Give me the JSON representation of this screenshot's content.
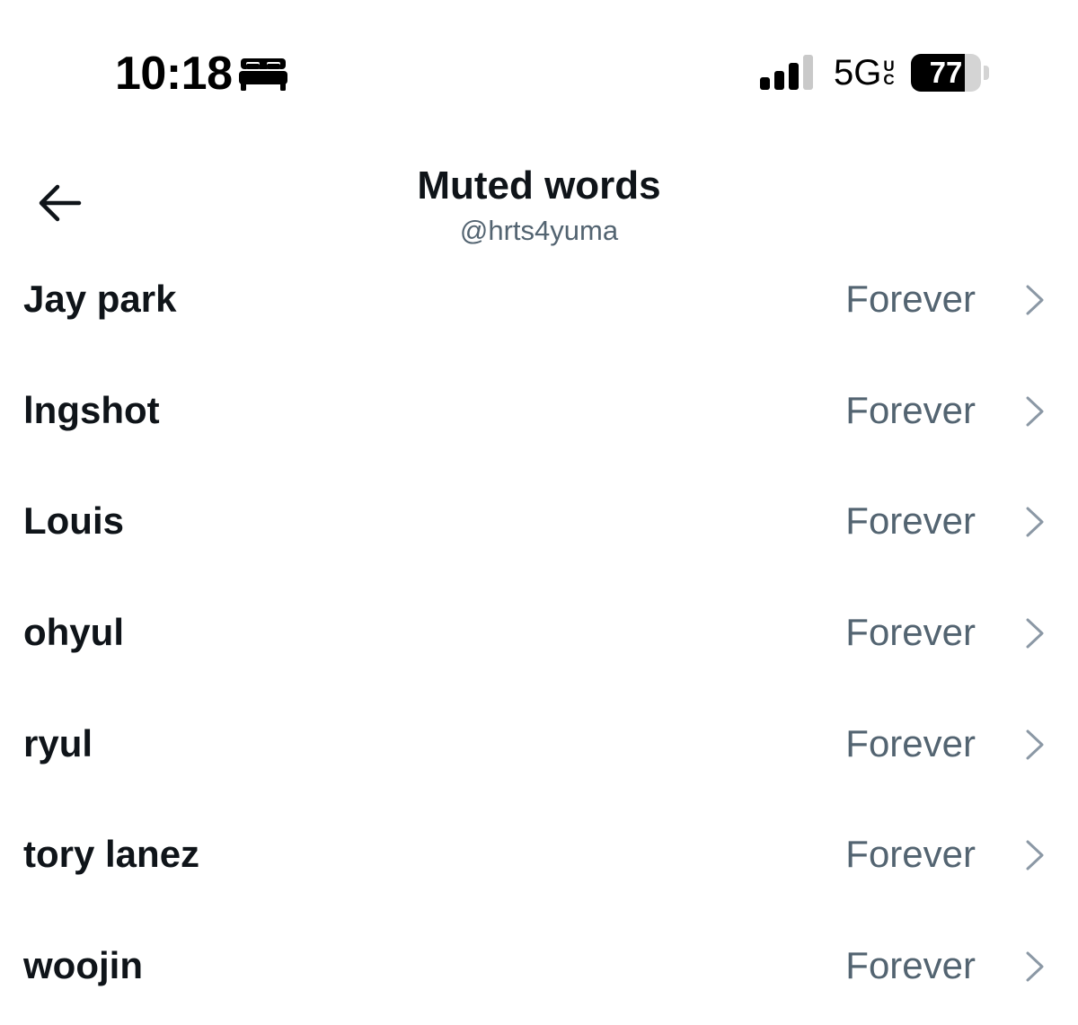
{
  "status_bar": {
    "time": "10:18",
    "focus_icon": "bed-icon",
    "signal_icon": "cellular-signal-icon",
    "signal_bars": 3,
    "network": "5G",
    "network_superscript": "U",
    "network_subscript": "C",
    "battery_level": "77",
    "battery_fraction": 0.77
  },
  "header": {
    "back_icon": "back-arrow-icon",
    "title": "Muted words",
    "subtitle": "@hrts4yuma"
  },
  "muted_words": [
    {
      "word": "Jay park",
      "duration": "Forever"
    },
    {
      "word": "lngshot",
      "duration": "Forever"
    },
    {
      "word": "Louis",
      "duration": "Forever"
    },
    {
      "word": "ohyul",
      "duration": "Forever"
    },
    {
      "word": "ryul",
      "duration": "Forever"
    },
    {
      "word": "tory lanez",
      "duration": "Forever"
    },
    {
      "word": "woojin",
      "duration": "Forever"
    }
  ],
  "colors": {
    "text_primary": "#0f1419",
    "text_secondary": "#536471",
    "chevron": "#8b98a5",
    "background": "#ffffff"
  }
}
